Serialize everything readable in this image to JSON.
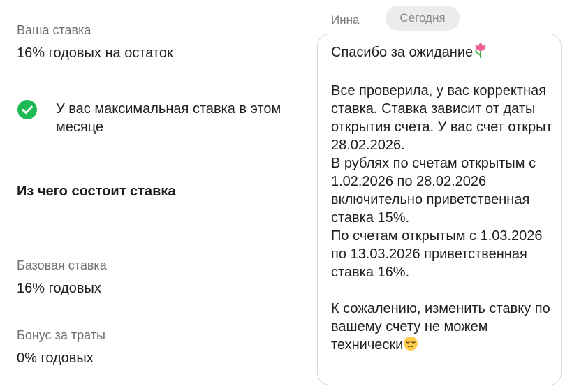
{
  "rate": {
    "your_rate_label": "Ваша ставка",
    "your_rate_value": "16% годовых на остаток",
    "max_rate_note": "У вас максимальная ставка в этом месяце",
    "composition_title": "Из чего состоит ставка",
    "base_label": "Базовая ставка",
    "base_value": "16% годовых",
    "bonus_label": "Бонус за траты",
    "bonus_value": "0% годовых"
  },
  "chat": {
    "sender": "Инна",
    "date_chip": "Сегодня",
    "message": {
      "greeting": "Спасибо за ожидание",
      "body": "Все проверила, у вас корректная ставка. Ставка зависит от даты открытия счета. У вас счет открыт 28.02.2026.\nВ рублях по счетам открытым с 1.02.2026 по 28.02.2026 включительно приветственная ставка 15%.\nПо счетам открытым с 1.03.2026 по 13.03.2026 приветственная ставка 16%.",
      "closing": "К сожалению, изменить ставку по вашему счету не можем технически"
    }
  },
  "icons": {
    "check": "check-circle-icon",
    "greeting_emoji": "tulip-icon",
    "closing_emoji": "pensive-face-icon"
  },
  "colors": {
    "check_green": "#1db954",
    "muted_text": "#6f6f6f",
    "chip_bg": "#ececec"
  }
}
